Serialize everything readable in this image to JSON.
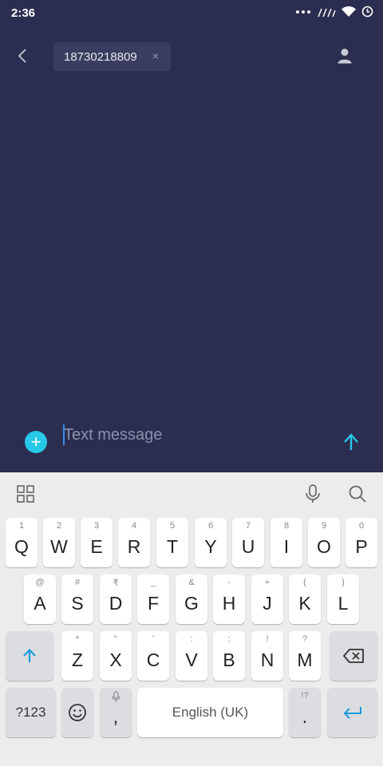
{
  "status_bar": {
    "time": "2:36"
  },
  "header": {
    "recipient": "18730218809",
    "chip_remove": "×"
  },
  "compose": {
    "placeholder": "Text message",
    "attach_label": "+"
  },
  "keyboard": {
    "row1": [
      {
        "key": "Q",
        "hint": "1"
      },
      {
        "key": "W",
        "hint": "2"
      },
      {
        "key": "E",
        "hint": "3"
      },
      {
        "key": "R",
        "hint": "4"
      },
      {
        "key": "T",
        "hint": "5"
      },
      {
        "key": "Y",
        "hint": "6"
      },
      {
        "key": "U",
        "hint": "7"
      },
      {
        "key": "I",
        "hint": "8"
      },
      {
        "key": "O",
        "hint": "9"
      },
      {
        "key": "P",
        "hint": "0"
      }
    ],
    "row2": [
      {
        "key": "A",
        "hint": "@"
      },
      {
        "key": "S",
        "hint": "#"
      },
      {
        "key": "D",
        "hint": "₹"
      },
      {
        "key": "F",
        "hint": "_"
      },
      {
        "key": "G",
        "hint": "&"
      },
      {
        "key": "H",
        "hint": "-"
      },
      {
        "key": "J",
        "hint": "+"
      },
      {
        "key": "K",
        "hint": "("
      },
      {
        "key": "L",
        "hint": ")"
      }
    ],
    "row3": [
      {
        "key": "Z",
        "hint": "*"
      },
      {
        "key": "X",
        "hint": "\""
      },
      {
        "key": "C",
        "hint": "'"
      },
      {
        "key": "V",
        "hint": ":"
      },
      {
        "key": "B",
        "hint": ";"
      },
      {
        "key": "N",
        "hint": "!"
      },
      {
        "key": "M",
        "hint": "?"
      }
    ],
    "symbols_label": "?123",
    "comma": ",",
    "space_label": "English (UK)",
    "period": ".",
    "period_hint": "!?"
  },
  "colors": {
    "background": "#2b2e50",
    "accent": "#28c8e8",
    "keyboard_bg": "#ececec"
  }
}
